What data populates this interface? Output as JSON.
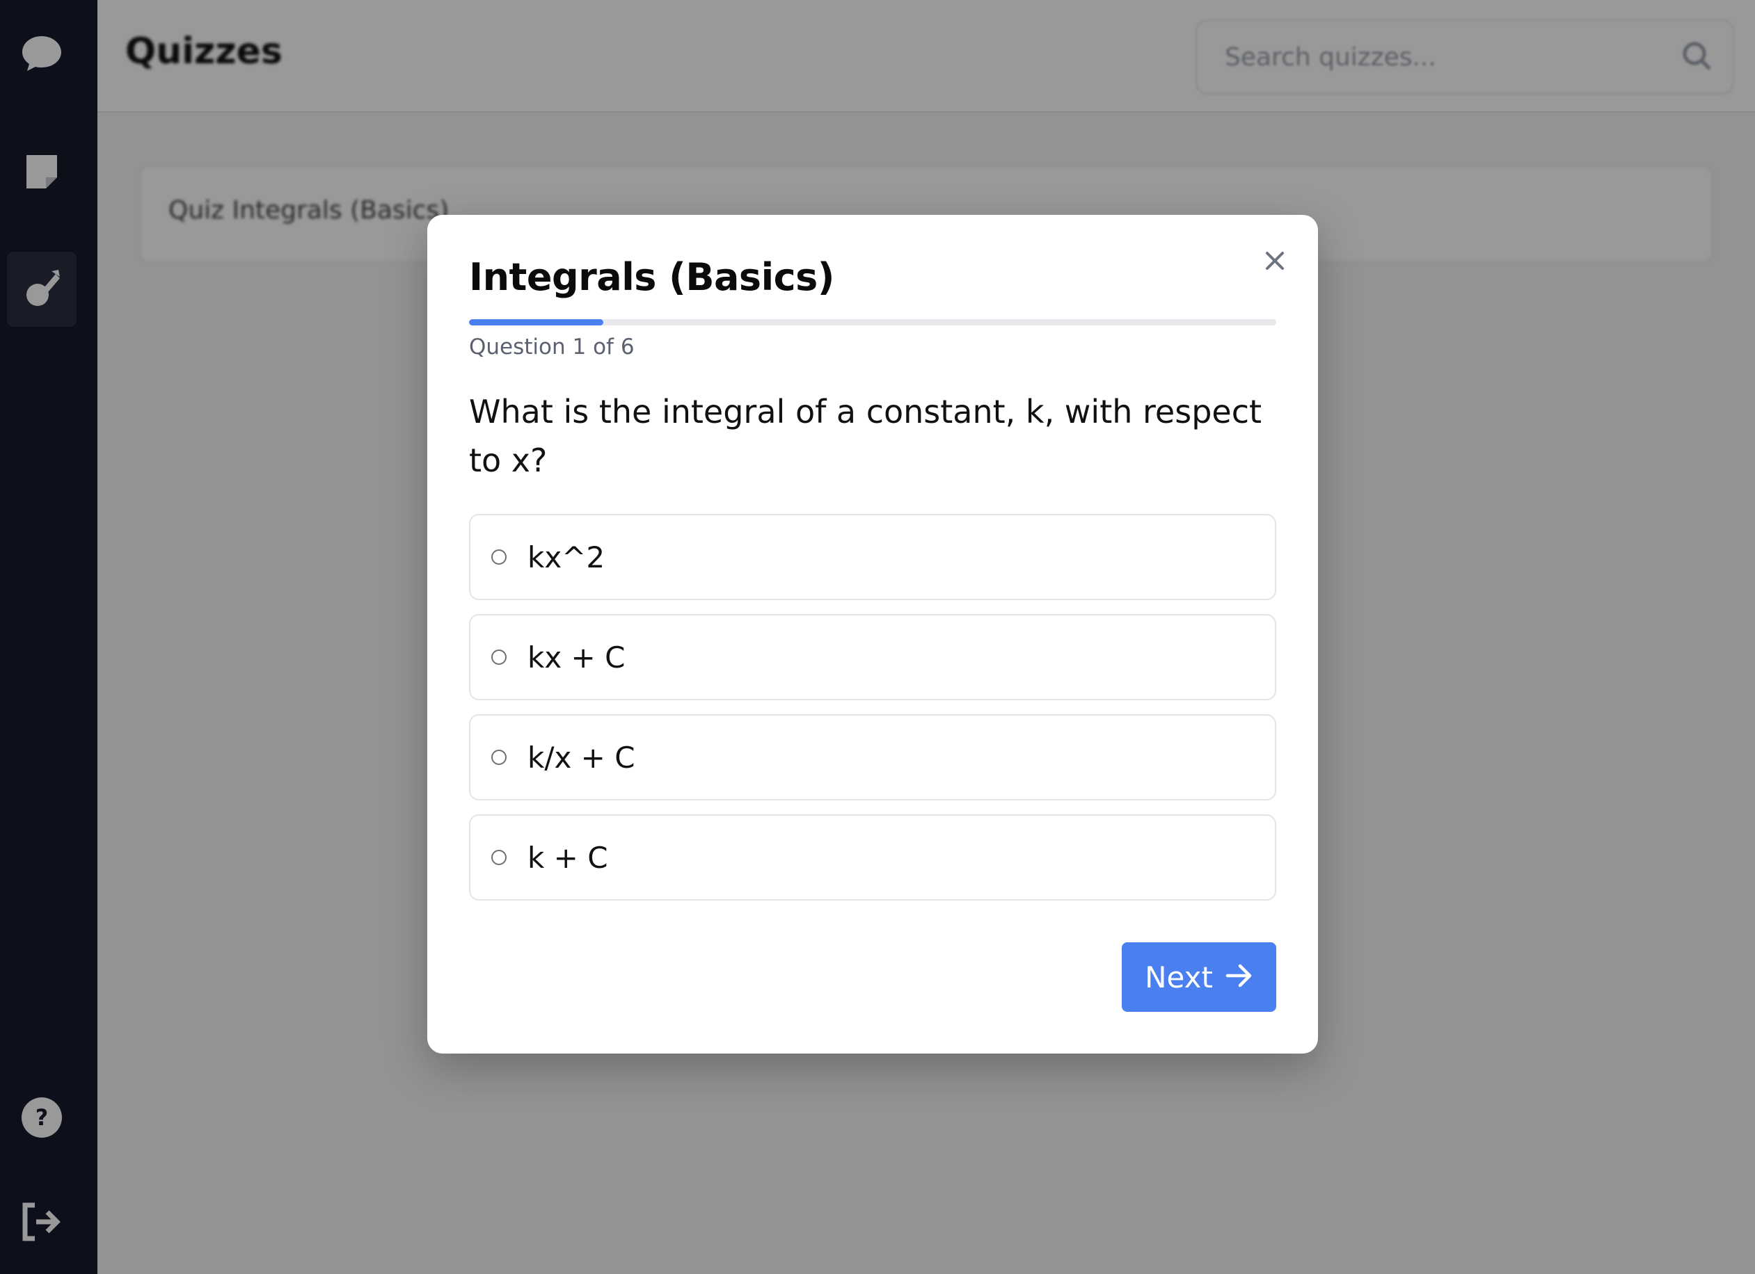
{
  "app": {
    "page_title": "Quizzes",
    "search": {
      "placeholder": "Search quizzes..."
    },
    "quiz_card_label": "Quiz Integrals (Basics)"
  },
  "sidebar": {
    "icons": [
      "chat-bubble-icon",
      "note-icon",
      "quiz-pen-icon",
      "help-icon",
      "logout-icon"
    ],
    "active": "quiz-pen-icon"
  },
  "modal": {
    "title": "Integrals (Basics)",
    "progress_fraction": 0.1667,
    "question_counter": "Question 1 of 6",
    "question": "What is the integral of a constant, k, with respect to x?",
    "options": [
      "kx^2",
      "kx + C",
      "k/x + C",
      "k + C"
    ],
    "next_label": "Next",
    "close_icon": "close-icon"
  },
  "colors": {
    "accent": "#4a7ff0",
    "sidebar_bg": "#161b2e"
  }
}
